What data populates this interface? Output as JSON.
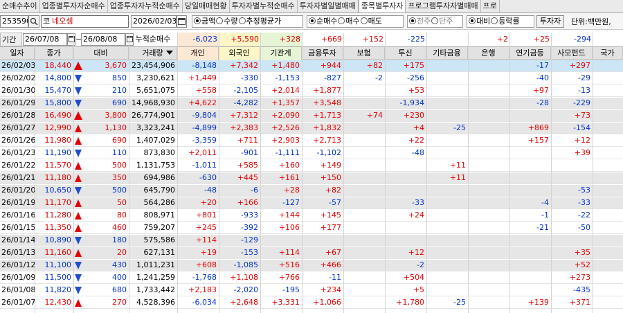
{
  "tabs": [
    "순매수추이",
    "업종별투자자순매수",
    "업종투자자누적순매수",
    "당일매매현황",
    "투자자별누적순매수",
    "투자자별일별매매",
    "종목별투자자",
    "프로그램투자자별매매",
    "프로"
  ],
  "active_tab": 6,
  "toolbar": {
    "code": "253590",
    "search_icon": "search-icon",
    "market_char": "코",
    "stock_name": "네오셈",
    "date": "2026/02/03",
    "unit_group": [
      "금액",
      "수량",
      "추정평균가"
    ],
    "unit_selected": 0,
    "trade_group": [
      "순매수",
      "매수",
      "매도"
    ],
    "trade_selected": 0,
    "share_group": [
      "천주",
      "단주"
    ],
    "share_selected": 0,
    "compare_group": [
      "대비",
      "등락률"
    ],
    "compare_selected": 0,
    "investor_button": "투자자",
    "unit_label": "단위:백만원,"
  },
  "period": {
    "label": "기간",
    "from": "26/07/08",
    "sep": "~",
    "to": "26/08/08",
    "cum_label": "누적순매수"
  },
  "summary": {
    "individual": "-6,023",
    "foreign": "+5,590",
    "institution": "+328",
    "fin_invest": "+669",
    "insurance": "+152",
    "trust": "-225",
    "other_fin": "",
    "bank": "+2",
    "pension": "+25",
    "pef": "-294"
  },
  "columns": [
    "일자",
    "종가",
    "대비",
    "거래량",
    "개인",
    "외국인",
    "기관계",
    "금융투자",
    "보험",
    "투신",
    "기타금융",
    "은행",
    "연기금등",
    "사모펀드",
    "국가"
  ],
  "rows": [
    {
      "date": "26/02/03",
      "close": "18,440",
      "dir": "upbig",
      "chg": "3,670",
      "vol": "23,454,906",
      "ind": "-8,148",
      "frn": "+7,342",
      "inst": "+1,480",
      "fin": "+944",
      "ins": "+82",
      "tru": "+175",
      "oth": "",
      "bank": "",
      "pen": "-17",
      "pef": "+297",
      "nat": ""
    },
    {
      "date": "26/02/02",
      "close": "14,800",
      "dir": "down",
      "chg": "850",
      "vol": "3,230,621",
      "ind": "+1,449",
      "frn": "-330",
      "inst": "-1,153",
      "fin": "-827",
      "ins": "-2",
      "tru": "-256",
      "oth": "",
      "bank": "",
      "pen": "-40",
      "pef": "-29",
      "nat": ""
    },
    {
      "date": "26/01/30",
      "close": "15,470",
      "dir": "down",
      "chg": "210",
      "vol": "5,651,075",
      "ind": "+558",
      "frn": "-2,105",
      "inst": "+2,014",
      "fin": "+1,877",
      "ins": "",
      "tru": "+53",
      "oth": "",
      "bank": "",
      "pen": "+97",
      "pef": "-13",
      "nat": ""
    },
    {
      "date": "26/01/29",
      "close": "15,800",
      "dir": "down",
      "chg": "690",
      "vol": "14,968,930",
      "ind": "+4,622",
      "frn": "-4,282",
      "inst": "+1,357",
      "fin": "+3,548",
      "ins": "",
      "tru": "-1,934",
      "oth": "",
      "bank": "",
      "pen": "-28",
      "pef": "-229",
      "nat": ""
    },
    {
      "date": "26/01/28",
      "close": "16,490",
      "dir": "upbig",
      "chg": "3,800",
      "vol": "26,774,901",
      "ind": "-9,804",
      "frn": "+7,312",
      "inst": "+2,090",
      "fin": "+1,713",
      "ins": "+74",
      "tru": "+230",
      "oth": "",
      "bank": "",
      "pen": "",
      "pef": "+73",
      "nat": ""
    },
    {
      "date": "26/01/27",
      "close": "12,990",
      "dir": "up",
      "chg": "1,130",
      "vol": "3,323,241",
      "ind": "-4,899",
      "frn": "+2,383",
      "inst": "+2,526",
      "fin": "+1,832",
      "ins": "",
      "tru": "+4",
      "oth": "-25",
      "bank": "",
      "pen": "+869",
      "pef": "-154",
      "nat": ""
    },
    {
      "date": "26/01/26",
      "close": "11,980",
      "dir": "up",
      "chg": "690",
      "vol": "1,407,029",
      "ind": "-3,359",
      "frn": "+711",
      "inst": "+2,903",
      "fin": "+2,713",
      "ins": "",
      "tru": "+22",
      "oth": "",
      "bank": "",
      "pen": "+157",
      "pef": "+12",
      "nat": ""
    },
    {
      "date": "26/01/23",
      "close": "11,190",
      "dir": "down",
      "chg": "110",
      "vol": "873,830",
      "ind": "+2,011",
      "frn": "-901",
      "inst": "-1,111",
      "fin": "-1,102",
      "ins": "",
      "tru": "-48",
      "oth": "",
      "bank": "",
      "pen": "",
      "pef": "+39",
      "nat": ""
    },
    {
      "date": "26/01/22",
      "close": "11,570",
      "dir": "up",
      "chg": "500",
      "vol": "1,131,753",
      "ind": "-1,011",
      "frn": "+585",
      "inst": "+160",
      "fin": "+149",
      "ins": "",
      "tru": "",
      "oth": "+11",
      "bank": "",
      "pen": "",
      "pef": "",
      "nat": ""
    },
    {
      "date": "26/01/21",
      "close": "11,180",
      "dir": "up",
      "chg": "350",
      "vol": "694,986",
      "ind": "-630",
      "frn": "+445",
      "inst": "+161",
      "fin": "+150",
      "ins": "",
      "tru": "",
      "oth": "+11",
      "bank": "",
      "pen": "",
      "pef": "",
      "nat": ""
    },
    {
      "date": "26/01/20",
      "close": "10,650",
      "dir": "down",
      "chg": "500",
      "vol": "645,790",
      "ind": "-48",
      "frn": "-6",
      "inst": "+28",
      "fin": "+82",
      "ins": "",
      "tru": "",
      "oth": "",
      "bank": "",
      "pen": "",
      "pef": "-53",
      "nat": ""
    },
    {
      "date": "26/01/19",
      "close": "11,170",
      "dir": "up",
      "chg": "50",
      "vol": "564,286",
      "ind": "+20",
      "frn": "+166",
      "inst": "-127",
      "fin": "-57",
      "ins": "",
      "tru": "-33",
      "oth": "",
      "bank": "",
      "pen": "-4",
      "pef": "-33",
      "nat": ""
    },
    {
      "date": "26/01/16",
      "close": "11,280",
      "dir": "up",
      "chg": "80",
      "vol": "808,971",
      "ind": "+801",
      "frn": "-933",
      "inst": "+144",
      "fin": "+145",
      "ins": "",
      "tru": "+24",
      "oth": "",
      "bank": "",
      "pen": "-1",
      "pef": "-22",
      "nat": ""
    },
    {
      "date": "26/01/15",
      "close": "11,350",
      "dir": "up",
      "chg": "460",
      "vol": "759,207",
      "ind": "+245",
      "frn": "-392",
      "inst": "+106",
      "fin": "+177",
      "ins": "",
      "tru": "",
      "oth": "",
      "bank": "",
      "pen": "-21",
      "pef": "-50",
      "nat": ""
    },
    {
      "date": "26/01/14",
      "close": "10,890",
      "dir": "down",
      "chg": "180",
      "vol": "575,586",
      "ind": "+114",
      "frn": "-129",
      "inst": "",
      "fin": "",
      "ins": "",
      "tru": "",
      "oth": "",
      "bank": "",
      "pen": "",
      "pef": "",
      "nat": ""
    },
    {
      "date": "26/01/13",
      "close": "11,160",
      "dir": "up",
      "chg": "20",
      "vol": "627,131",
      "ind": "+19",
      "frn": "-153",
      "inst": "+114",
      "fin": "+67",
      "ins": "",
      "tru": "+12",
      "oth": "",
      "bank": "",
      "pen": "",
      "pef": "+35",
      "nat": ""
    },
    {
      "date": "26/01/12",
      "close": "11,100",
      "dir": "down",
      "chg": "430",
      "vol": "1,011,231",
      "ind": "+608",
      "frn": "-1,085",
      "inst": "+516",
      "fin": "+466",
      "ins": "",
      "tru": "-2",
      "oth": "",
      "bank": "",
      "pen": "",
      "pef": "+52",
      "nat": ""
    },
    {
      "date": "26/01/09",
      "close": "11,500",
      "dir": "down",
      "chg": "400",
      "vol": "1,241,259",
      "ind": "-1,768",
      "frn": "+1,108",
      "inst": "+766",
      "fin": "-11",
      "ins": "",
      "tru": "+504",
      "oth": "",
      "bank": "",
      "pen": "",
      "pef": "+273",
      "nat": ""
    },
    {
      "date": "26/01/08",
      "close": "11,820",
      "dir": "down",
      "chg": "680",
      "vol": "1,733,442",
      "ind": "+2,183",
      "frn": "-2,020",
      "inst": "-195",
      "fin": "+234",
      "ins": "",
      "tru": "+5",
      "oth": "",
      "bank": "",
      "pen": "",
      "pef": "-435",
      "nat": ""
    },
    {
      "date": "26/01/07",
      "close": "12,430",
      "dir": "up",
      "chg": "270",
      "vol": "4,528,396",
      "ind": "-6,034",
      "frn": "+2,648",
      "inst": "+3,331",
      "fin": "+1,066",
      "ins": "",
      "tru": "+1,780",
      "oth": "-25",
      "bank": "",
      "pen": "+139",
      "pef": "+371",
      "nat": ""
    }
  ],
  "colors": {
    "up": "#e60000",
    "down": "#0033cc",
    "selected_row": "#cde6f5"
  }
}
